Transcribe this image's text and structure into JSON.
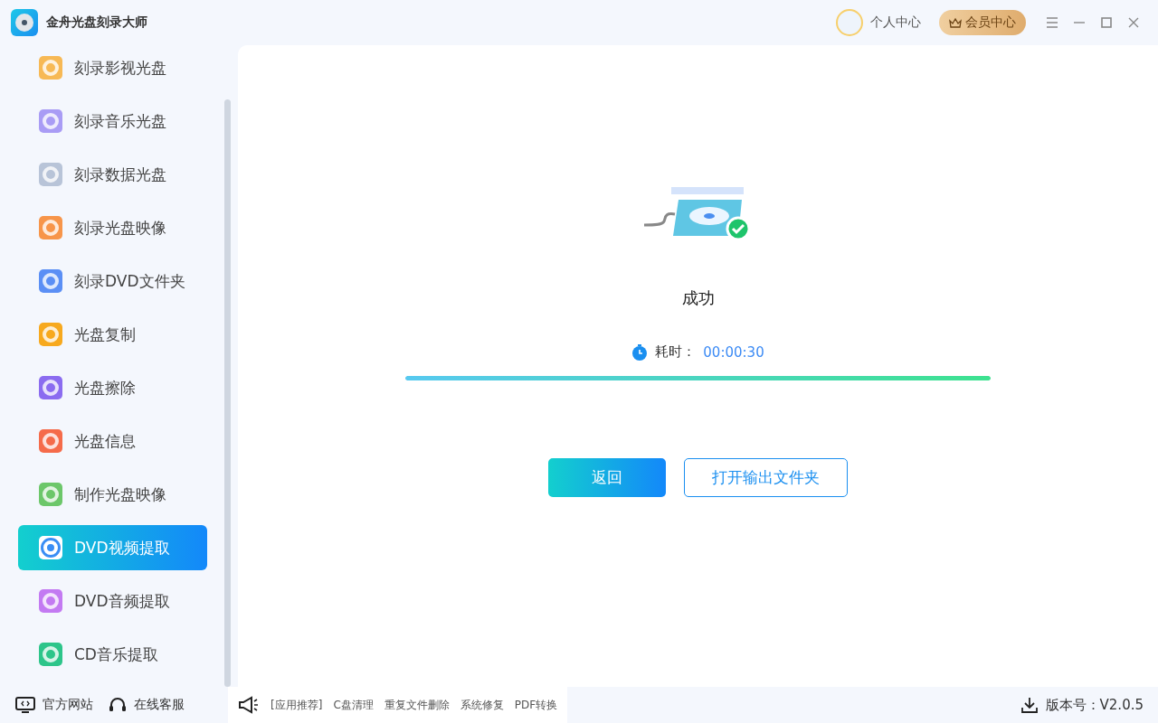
{
  "window": {
    "title": "金舟光盘刻录大师"
  },
  "header": {
    "user": "个人中心",
    "vip": "会员中心"
  },
  "sidebar": {
    "items": [
      {
        "label": "刻录影视光盘",
        "color": "#f7b955",
        "selected": false
      },
      {
        "label": "刻录音乐光盘",
        "color": "#a99cf5",
        "selected": false
      },
      {
        "label": "刻录数据光盘",
        "color": "#b8c4d8",
        "selected": false
      },
      {
        "label": "刻录光盘映像",
        "color": "#f7954a",
        "selected": false
      },
      {
        "label": "刻录DVD文件夹",
        "color": "#5b8ff5",
        "selected": false
      },
      {
        "label": "光盘复制",
        "color": "#f7a91e",
        "selected": false
      },
      {
        "label": "光盘擦除",
        "color": "#8b6cf0",
        "selected": false
      },
      {
        "label": "光盘信息",
        "color": "#f56b4a",
        "selected": false
      },
      {
        "label": "制作光盘映像",
        "color": "#6cc76a",
        "selected": false
      },
      {
        "label": "DVD视频提取",
        "color": "#3a8ef5",
        "selected": true
      },
      {
        "label": "DVD音频提取",
        "color": "#c37af2",
        "selected": false
      },
      {
        "label": "CD音乐提取",
        "color": "#2dc58a",
        "selected": false
      }
    ]
  },
  "result": {
    "status": "成功",
    "time_label": "耗时：",
    "time_value": "00:00:30",
    "level": 1
  },
  "buttons": {
    "back": "返回",
    "open_folder": "打开输出文件夹"
  },
  "footer": {
    "links": [
      "官方网站",
      "在线客服"
    ],
    "recommend": [
      "[应用推荐]",
      "C盘清理",
      "重复文件删除",
      "系统修复",
      "PDF转换"
    ],
    "version": "版本号：V2.0.5"
  }
}
